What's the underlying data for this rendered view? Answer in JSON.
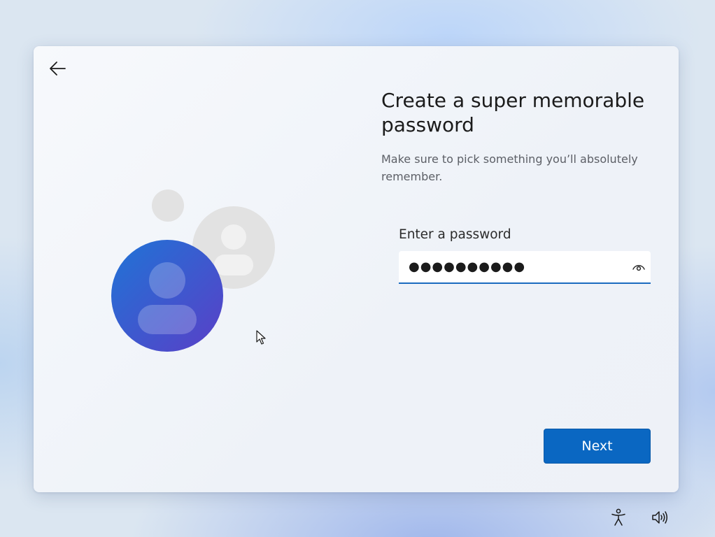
{
  "page": {
    "title": "Create a super memorable password",
    "subtitle": "Make sure to pick something you’ll absolutely remember."
  },
  "password_field": {
    "label": "Enter a password",
    "value": "●●●●●●●●●●"
  },
  "buttons": {
    "next_label": "Next"
  },
  "icons": {
    "back": "back-arrow-icon",
    "reveal": "eye-icon",
    "accessibility": "accessibility-icon",
    "volume": "volume-icon"
  },
  "colors": {
    "accent": "#0a67c2",
    "avatar_gradient_start": "#1f74d6",
    "avatar_gradient_end": "#5a3fc7"
  }
}
